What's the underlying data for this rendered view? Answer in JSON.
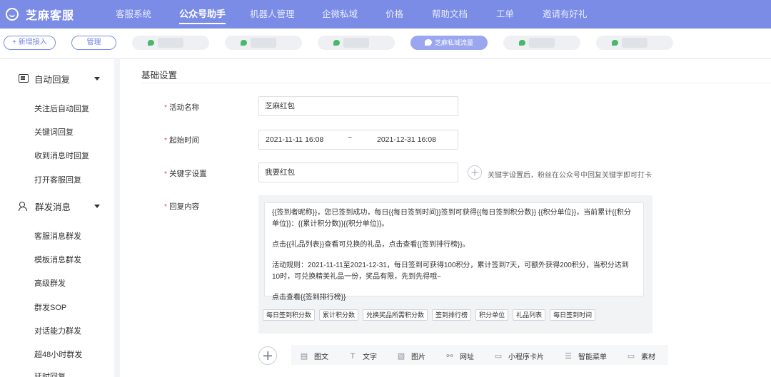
{
  "brand": {
    "name": "芝麻客服",
    "icon": "smile-circle-icon"
  },
  "nav": [
    {
      "label": "客服系统",
      "active": false
    },
    {
      "label": "公众号助手",
      "active": true
    },
    {
      "label": "机器人管理",
      "active": false
    },
    {
      "label": "企微私域",
      "active": false
    },
    {
      "label": "价格",
      "active": false
    },
    {
      "label": "帮助文档",
      "active": false
    },
    {
      "label": "工单",
      "active": false
    },
    {
      "label": "邀请有好礼",
      "active": false
    }
  ],
  "strip": {
    "add_label": "+ 新增接入",
    "manage_label": "管理",
    "active_account": "芝麻私域流量"
  },
  "sidebar": {
    "group1": {
      "label": "自动回复",
      "icon": "message-square-icon"
    },
    "group1_items": [
      "关注后自动回复",
      "关键词回复",
      "收到消息时回复",
      "打开客服回复"
    ],
    "group2": {
      "label": "群发消息",
      "icon": "users-icon"
    },
    "group2_items": [
      "客服消息群发",
      "模板消息群发",
      "高级群发",
      "群发SOP",
      "对话能力群发",
      "超48小时群发",
      "延时回复"
    ]
  },
  "form": {
    "section_title": "基础设置",
    "name_label": "活动名称",
    "name_value": "芝麻红包",
    "time_label": "起始时间",
    "start_time": "2021-11-11 16:08",
    "time_sep": "~",
    "end_time": "2021-12-31 16:08",
    "keyword_label": "关键字设置",
    "keyword_value": "我要红包",
    "keyword_hint": "关键字设置后，粉丝在公众号中回复关键字即可打卡",
    "reply_label": "回复内容",
    "reply_paragraphs": [
      "{{签到者昵称}}，您已签到成功，每日{{每日签到时间}}签到可获得{{每日签到积分数}} {{积分单位}}，当前累计{{积分单位}}：{{累计积分数}}{{积分单位}}。",
      "点击{{礼品列表}}查看可兑换的礼品，点击查看{{签到排行榜}}。",
      "活动规则：2021-11-11至2021-12-31，每日签到可获得100积分，累计签到7天，可额外获得200积分，当积分达到10时，可兑换精美礼品一份，奖品有限，先到先得哦~",
      "点击查看{{签到排行榜}}"
    ],
    "tags": [
      "每日签到积分数",
      "累计积分数",
      "兑换奖品所需积分数",
      "签到排行榜",
      "积分单位",
      "礼品列表",
      "每日签到时间"
    ]
  },
  "toolbar": [
    {
      "label": "图文",
      "icon": "article-icon",
      "glyph": "▤"
    },
    {
      "label": "文字",
      "icon": "text-icon",
      "glyph": "T"
    },
    {
      "label": "图片",
      "icon": "image-icon",
      "glyph": "▧"
    },
    {
      "label": "网址",
      "icon": "link-icon",
      "glyph": "⚯"
    },
    {
      "label": "小程序卡片",
      "icon": "miniprogram-card-icon",
      "glyph": "▭"
    },
    {
      "label": "智能菜单",
      "icon": "menu-icon",
      "glyph": "☰"
    },
    {
      "label": "素材",
      "icon": "material-icon",
      "glyph": "▭"
    }
  ],
  "colors": {
    "nav_bg": "#7b8ce6",
    "accent": "#6d7fe0",
    "required": "#e54d42",
    "wechat_green": "#49b86a"
  }
}
